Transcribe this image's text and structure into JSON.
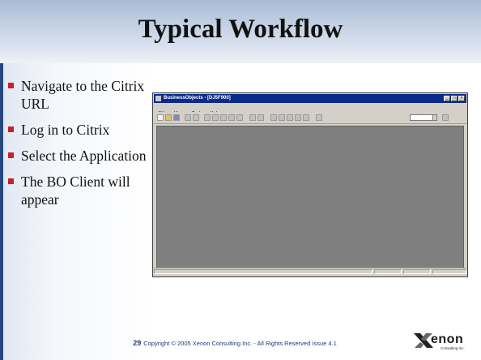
{
  "slide": {
    "title": "Typical Workflow",
    "bullets": [
      "Navigate to the Citrix URL",
      "Log in to Citrix",
      "Select the Application",
      "The BO Client will appear"
    ],
    "accent_color": "#cc1f27",
    "title_band_color": "#a9bcd6"
  },
  "app_window": {
    "title": "BusinessObjects - [DJ5F900]",
    "window_buttons": [
      "_",
      "□",
      "×"
    ],
    "menu": [
      "File",
      "View",
      "Tools",
      "Help"
    ],
    "toolbar_icons": [
      "new-icon",
      "open-icon",
      "save-icon",
      "print-icon",
      "preview-icon",
      "cut-icon",
      "copy-icon",
      "paste-icon",
      "delete-icon",
      "format-icon",
      "undo-icon",
      "redo-icon",
      "table-icon",
      "chart-icon",
      "filter-icon",
      "sort-icon",
      "drill-icon",
      "zoom-icon",
      "help-icon"
    ],
    "workspace_color": "#807f7f"
  },
  "footer": {
    "page_number": "29",
    "copyright": "Copyright © 2005  Xenon Consulting Inc. - All Rights Reserved  Issue 4.1"
  },
  "logo": {
    "word": "enon",
    "tagline": "Consulting Inc."
  }
}
